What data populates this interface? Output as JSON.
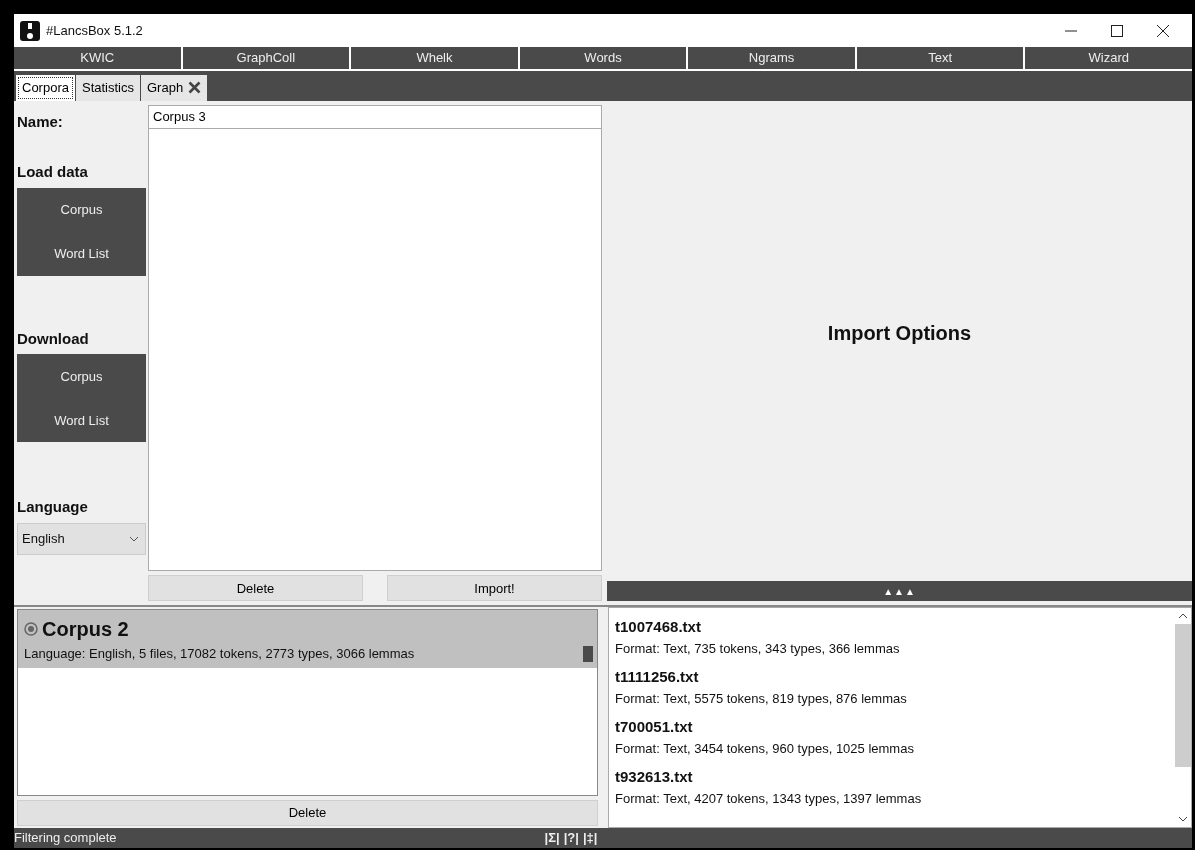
{
  "window": {
    "title": "#LancsBox 5.1.2"
  },
  "modules": [
    "KWIC",
    "GraphColl",
    "Whelk",
    "Words",
    "Ngrams",
    "Text",
    "Wizard"
  ],
  "tabs": [
    {
      "label": "Corpora",
      "selected": true,
      "closable": false
    },
    {
      "label": "Statistics",
      "selected": false,
      "closable": false
    },
    {
      "label": "Graph",
      "selected": false,
      "closable": true
    }
  ],
  "sidebar": {
    "name_label": "Name:",
    "load_heading": "Load data",
    "load_buttons": [
      "Corpus",
      "Word List"
    ],
    "download_heading": "Download",
    "download_buttons": [
      "Corpus",
      "Word List"
    ],
    "language_heading": "Language",
    "language": "English"
  },
  "name_field": {
    "value": "Corpus 3"
  },
  "import_buttons": [
    "Delete",
    "Import!"
  ],
  "import_options": {
    "title": "Import Options",
    "expand": "▲▲▲"
  },
  "corpora": [
    {
      "name": "Corpus 2",
      "info": "Language: English, 5 files, 17082 tokens, 2773 types, 3066 lemmas",
      "selected": true
    }
  ],
  "corpus_delete": "Delete",
  "files": [
    {
      "name": "t1007468.txt",
      "info": "Format: Text, 735 tokens, 343 types, 366 lemmas"
    },
    {
      "name": "t1111256.txt",
      "info": "Format: Text, 5575 tokens, 819 types, 876 lemmas"
    },
    {
      "name": "t700051.txt",
      "info": "Format: Text, 3454 tokens, 960 types, 1025 lemmas"
    },
    {
      "name": "t932613.txt",
      "info": "Format: Text, 4207 tokens, 1343 types, 1397 lemmas"
    }
  ],
  "status_bar": {
    "message": "Filtering complete",
    "tools": [
      "|Σ|",
      "|?|",
      "|‡|"
    ]
  }
}
